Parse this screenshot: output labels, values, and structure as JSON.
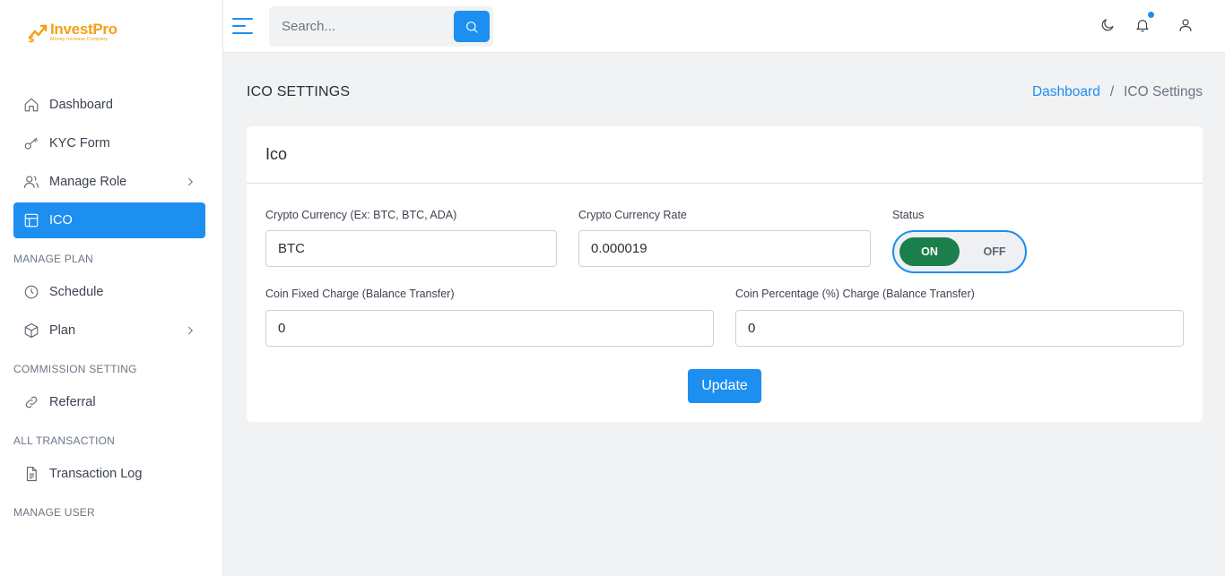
{
  "brand": {
    "name": "InvestPro",
    "tagline": "Money Increase Company",
    "color": "#f4a016"
  },
  "colors": {
    "accent": "#1d8ff0",
    "toggle_on": "#1b7f4c"
  },
  "sidebar": {
    "items": [
      {
        "label": "Dashboard",
        "icon": "home-icon"
      },
      {
        "label": "KYC Form",
        "icon": "key-icon"
      },
      {
        "label": "Manage Role",
        "icon": "users-icon"
      },
      {
        "label": "ICO",
        "icon": "layout-icon",
        "active": true
      }
    ],
    "sections": [
      {
        "title": "MANAGE PLAN",
        "items": [
          {
            "label": "Schedule",
            "icon": "clock-icon"
          },
          {
            "label": "Plan",
            "icon": "box-icon"
          }
        ]
      },
      {
        "title": "COMMISSION SETTING",
        "items": [
          {
            "label": "Referral",
            "icon": "link-icon"
          }
        ]
      },
      {
        "title": "ALL TRANSACTION",
        "items": [
          {
            "label": "Transaction Log",
            "icon": "file-icon"
          }
        ]
      },
      {
        "title": "MANAGE USER",
        "items": []
      }
    ]
  },
  "topbar": {
    "search_placeholder": "Search..."
  },
  "page": {
    "title": "ICO SETTINGS",
    "breadcrumb": {
      "home": "Dashboard",
      "sep": "/",
      "current": "ICO Settings"
    }
  },
  "card": {
    "title": "Ico",
    "fields": {
      "crypto_currency": {
        "label": "Crypto Currency (Ex: BTC, BTC, ADA)",
        "value": "BTC"
      },
      "crypto_rate": {
        "label": "Crypto Currency Rate",
        "value": "0.000019"
      },
      "status": {
        "label": "Status",
        "on": "ON",
        "off": "OFF",
        "state": "ON"
      },
      "coin_fixed_charge": {
        "label": "Coin Fixed Charge (Balance Transfer)",
        "value": "0"
      },
      "coin_percent_charge": {
        "label": "Coin Percentage (%) Charge (Balance Transfer)",
        "value": "0"
      }
    },
    "submit_label": "Update"
  }
}
